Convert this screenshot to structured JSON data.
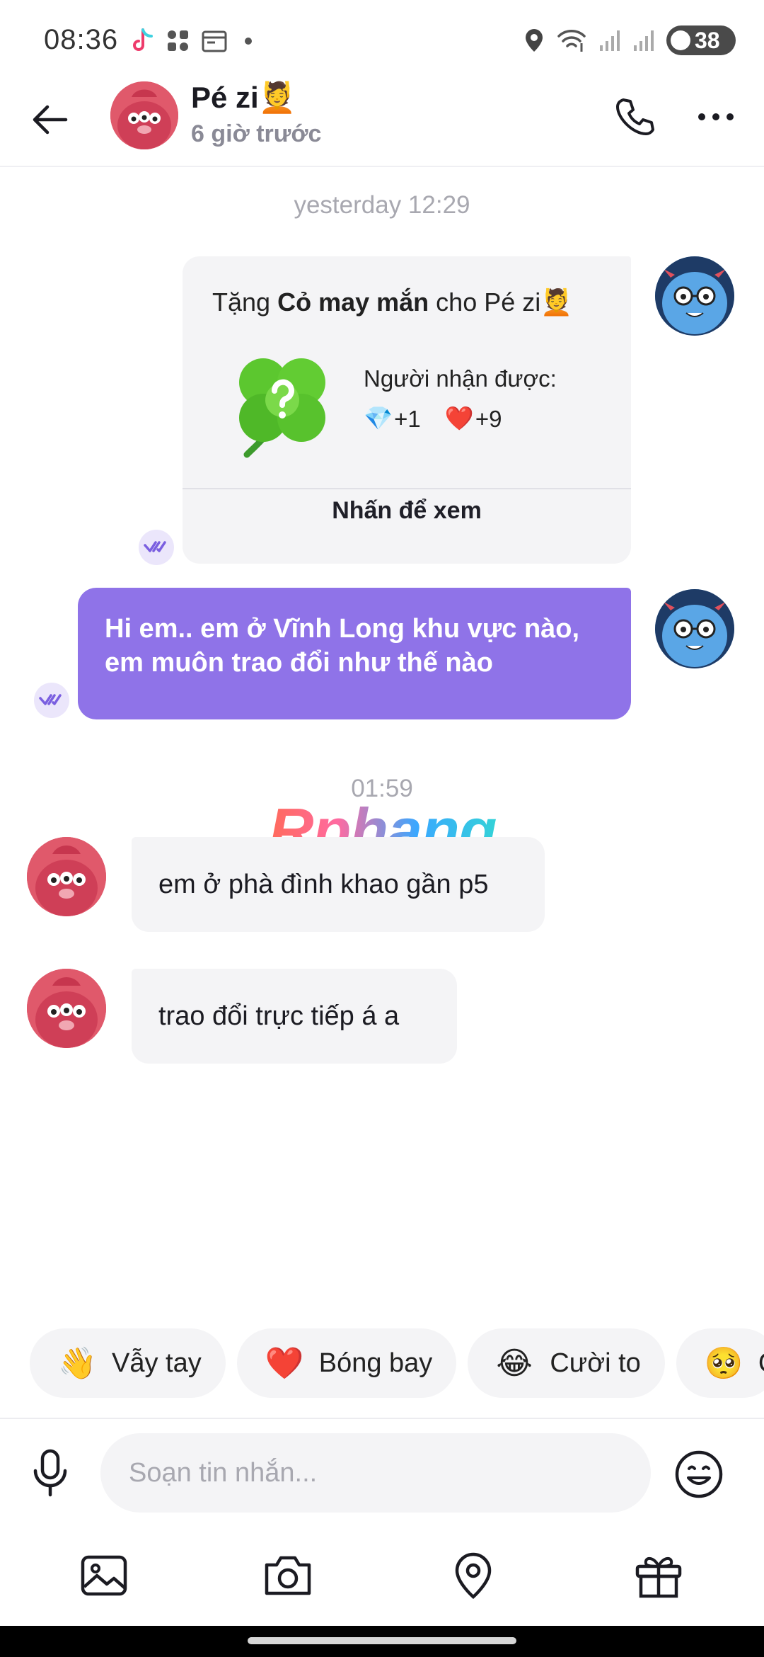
{
  "status_bar": {
    "time": "08:36",
    "battery": "38",
    "icons_left": [
      "tiktok-icon",
      "grid-icon",
      "calendar-icon",
      "dot"
    ],
    "icons_right": [
      "location-icon",
      "wifi-icon",
      "signal-icon",
      "signal-icon",
      "battery-icon"
    ]
  },
  "header": {
    "name": "Pé zi💆",
    "status": "6 giờ trước",
    "icons": [
      "back-arrow-icon",
      "phone-icon",
      "more-icon"
    ]
  },
  "messages": {
    "timestamp_1": "yesterday 12:29",
    "gift": {
      "title_prefix": "Tặng",
      "gift_name": "Cỏ may mắn",
      "title_suffix": "cho Pé zi💆",
      "receiver_label": "Người nhận được:",
      "diamond": "💎",
      "diamond_value": "+1",
      "heart": "❤️",
      "heart_value": "+9",
      "view_label": "Nhấn để xem"
    },
    "sent_1": "Hi em.. em ở Vĩnh Long khu vực nào, em muôn trao đổi như thế nào",
    "timestamp_2": "01:59",
    "received_1": "em ở phà đình khao gần p5",
    "received_2": "trao đổi trực tiếp á a"
  },
  "watermark": "Rphang",
  "quick_reactions": [
    {
      "emoji": "👋",
      "label": "Vẫy tay"
    },
    {
      "emoji": "❤️",
      "label": "Bóng bay"
    },
    {
      "emoji": "😂",
      "label": "Cười to"
    },
    {
      "emoji": "🥺",
      "label": "C"
    }
  ],
  "composer": {
    "placeholder": "Soạn tin nhắn..."
  },
  "toolbar": [
    "image-icon",
    "camera-icon",
    "location-icon",
    "gift-icon"
  ],
  "colors": {
    "accent": "#8f73e8",
    "bubble_in": "#f4f4f6",
    "timestamp": "#a8a8b0"
  }
}
